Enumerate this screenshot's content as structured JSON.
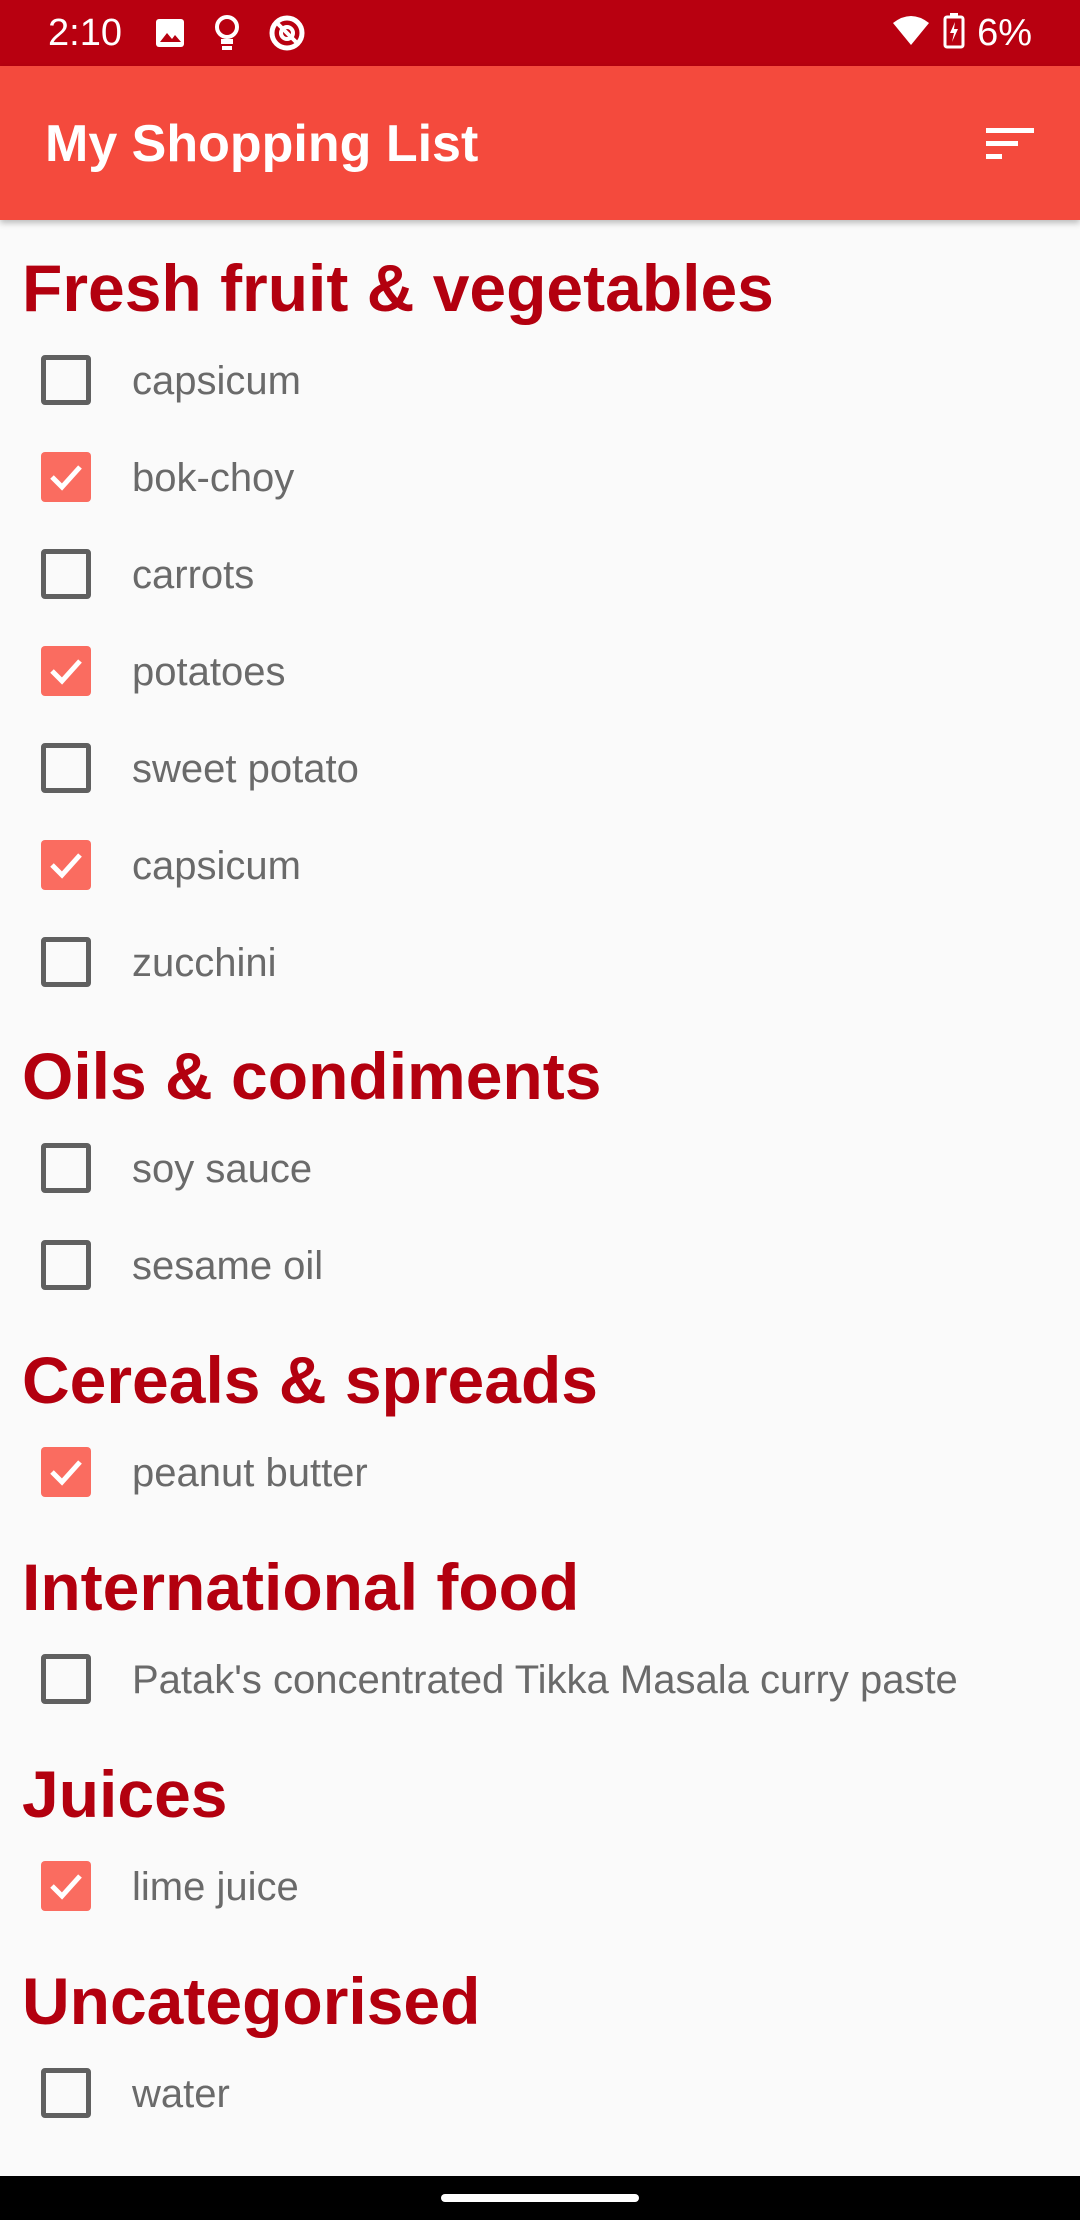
{
  "status_bar": {
    "time": "2:10",
    "left_icons": [
      "image-icon",
      "lightbulb-icon",
      "at-sign-icon"
    ],
    "right_icons": [
      "wifi-icon",
      "battery-charging-icon"
    ],
    "battery": "6%"
  },
  "app_bar": {
    "title": "My Shopping List",
    "sort_icon": "sort-icon"
  },
  "colors": {
    "status_bar": "#b80010",
    "app_bar": "#f44a3d",
    "heading": "#b3000f",
    "checked": "#fa6c60",
    "item_text": "#6a6a6a"
  },
  "sections": [
    {
      "title": "Fresh fruit & vegetables",
      "items": [
        {
          "label": "capsicum",
          "checked": false
        },
        {
          "label": "bok-choy",
          "checked": true
        },
        {
          "label": "carrots",
          "checked": false
        },
        {
          "label": "potatoes",
          "checked": true
        },
        {
          "label": "sweet potato",
          "checked": false
        },
        {
          "label": "capsicum",
          "checked": true
        },
        {
          "label": "zucchini",
          "checked": false
        }
      ]
    },
    {
      "title": "Oils & condiments",
      "items": [
        {
          "label": "soy sauce",
          "checked": false
        },
        {
          "label": "sesame oil",
          "checked": false
        }
      ]
    },
    {
      "title": "Cereals & spreads",
      "items": [
        {
          "label": "peanut butter",
          "checked": true
        }
      ]
    },
    {
      "title": "International food",
      "items": [
        {
          "label": "Patak's concentrated Tikka Masala curry paste",
          "checked": false
        }
      ]
    },
    {
      "title": "Juices",
      "items": [
        {
          "label": "lime juice",
          "checked": true
        }
      ]
    },
    {
      "title": "Uncategorised",
      "items": [
        {
          "label": "water",
          "checked": false
        }
      ]
    }
  ]
}
